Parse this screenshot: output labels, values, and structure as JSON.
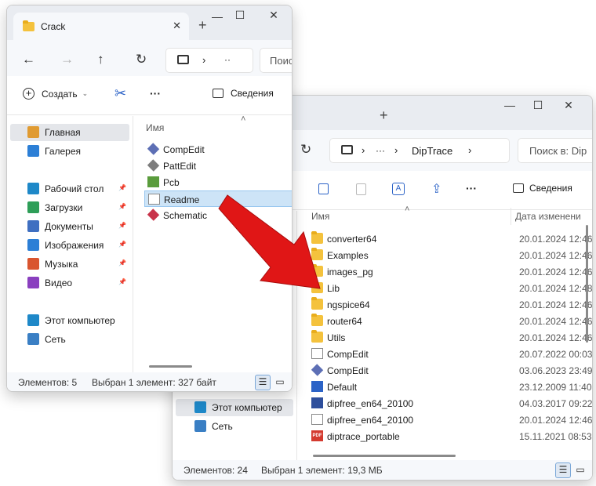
{
  "win1": {
    "tab_title": "Crack",
    "address_more": "··",
    "search_placeholder": "Поис",
    "toolbar": {
      "create_label": "Создать",
      "details_label": "Сведения",
      "more": "···"
    },
    "sidebar": [
      {
        "label": "Главная",
        "icon": "home-icon",
        "selected": true
      },
      {
        "label": "Галерея",
        "icon": "gallery-icon"
      },
      {
        "label": "Рабочий стол",
        "icon": "desktop-icon",
        "pinned": true
      },
      {
        "label": "Загрузки",
        "icon": "downloads-icon",
        "pinned": true
      },
      {
        "label": "Документы",
        "icon": "documents-icon",
        "pinned": true
      },
      {
        "label": "Изображения",
        "icon": "pictures-icon",
        "pinned": true
      },
      {
        "label": "Музыка",
        "icon": "music-icon",
        "pinned": true
      },
      {
        "label": "Видео",
        "icon": "video-icon",
        "pinned": true
      },
      {
        "label": "Этот компьютер",
        "icon": "this-pc-icon"
      },
      {
        "label": "Сеть",
        "icon": "network-icon"
      }
    ],
    "column_name": "Имя",
    "files": [
      {
        "name": "CompEdit",
        "icon": "compedit-icon"
      },
      {
        "name": "PattEdit",
        "icon": "pattedit-icon"
      },
      {
        "name": "Pcb",
        "icon": "pcb-icon"
      },
      {
        "name": "Readme",
        "icon": "text-file-icon",
        "selected": true
      },
      {
        "name": "Schematic",
        "icon": "schematic-icon"
      }
    ],
    "status": {
      "count": "Элементов: 5",
      "selection": "Выбран 1 элемент: 327 байт"
    }
  },
  "win2": {
    "breadcrumb_more": "···",
    "breadcrumb_folder": "DipTrace",
    "search_placeholder": "Поиск в: Dip",
    "toolbar": {
      "details_label": "Сведения",
      "more": "···"
    },
    "sidebar": [
      {
        "label": "Этот компьютер",
        "icon": "this-pc-icon",
        "selected": true
      },
      {
        "label": "Сеть",
        "icon": "network-icon"
      }
    ],
    "column_name": "Имя",
    "column_date": "Дата изменени",
    "files": [
      {
        "name": "converter64",
        "date": "20.01.2024 12:46",
        "icon": "folder-icon"
      },
      {
        "name": "Examples",
        "date": "20.01.2024 12:46",
        "icon": "folder-icon"
      },
      {
        "name": "images_pg",
        "date": "20.01.2024 12:46",
        "icon": "folder-icon"
      },
      {
        "name": "Lib",
        "date": "20.01.2024 12:48",
        "icon": "folder-icon"
      },
      {
        "name": "ngspice64",
        "date": "20.01.2024 12:46",
        "icon": "folder-icon"
      },
      {
        "name": "router64",
        "date": "20.01.2024 12:46",
        "icon": "folder-icon"
      },
      {
        "name": "Utils",
        "date": "20.01.2024 12:46",
        "icon": "folder-icon"
      },
      {
        "name": "CompEdit",
        "date": "20.07.2022 00:03",
        "icon": "help-file-icon"
      },
      {
        "name": "CompEdit",
        "date": "03.06.2023 23:49",
        "icon": "compedit-icon"
      },
      {
        "name": "Default",
        "date": "23.12.2009 11:40",
        "icon": "default-file-icon"
      },
      {
        "name": "dipfree_en64_20100",
        "date": "04.03.2017 09:22",
        "icon": "exe-icon"
      },
      {
        "name": "dipfree_en64_20100",
        "date": "20.01.2024 12:46",
        "icon": "text-file-icon"
      },
      {
        "name": "diptrace_portable",
        "date": "15.11.2021 08:53",
        "icon": "pdf-icon"
      }
    ],
    "status": {
      "count": "Элементов: 24",
      "selection": "Выбран 1 элемент: 19,3 МБ"
    }
  },
  "colors": {
    "arrow": "#e01616",
    "selection": "#cde4f7",
    "folder": "#f4c23d"
  }
}
